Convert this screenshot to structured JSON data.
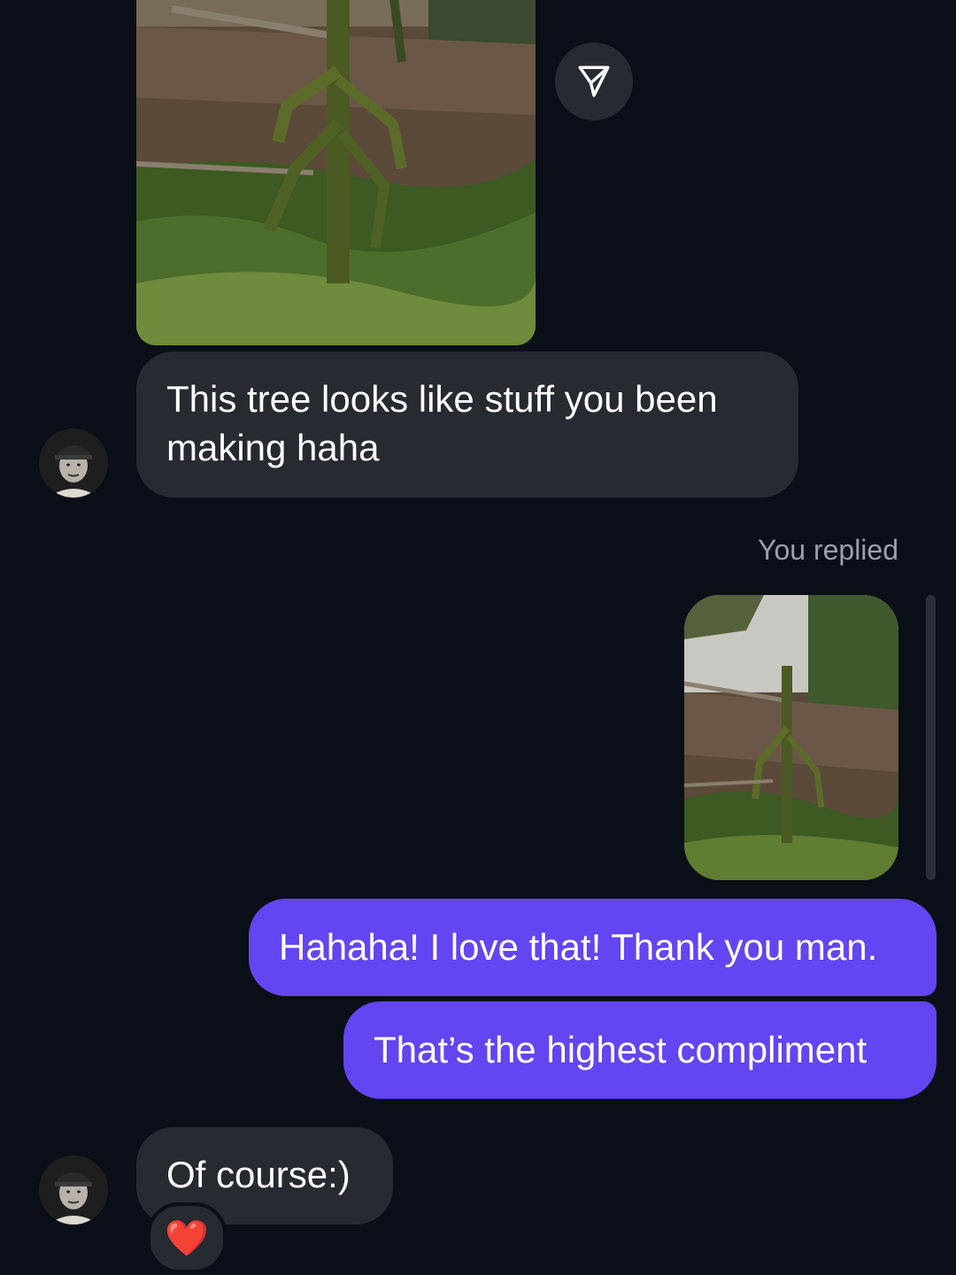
{
  "messages": {
    "first_text": "This tree looks like stuff you been making haha",
    "replied_label": "You replied",
    "reply_1": "Hahaha! I love that! Thank you man.",
    "reply_2": "That’s the highest compliment",
    "last_text": "Of course:)"
  },
  "reaction": {
    "emoji": "❤️"
  },
  "icons": {
    "share": "paper-plane-icon",
    "reaction": "heart-icon"
  },
  "colors": {
    "background": "#0b0f17",
    "incoming_bubble": "#262a31",
    "outgoing_bubble": "#6345f1",
    "muted_text": "#9ca0a8"
  }
}
